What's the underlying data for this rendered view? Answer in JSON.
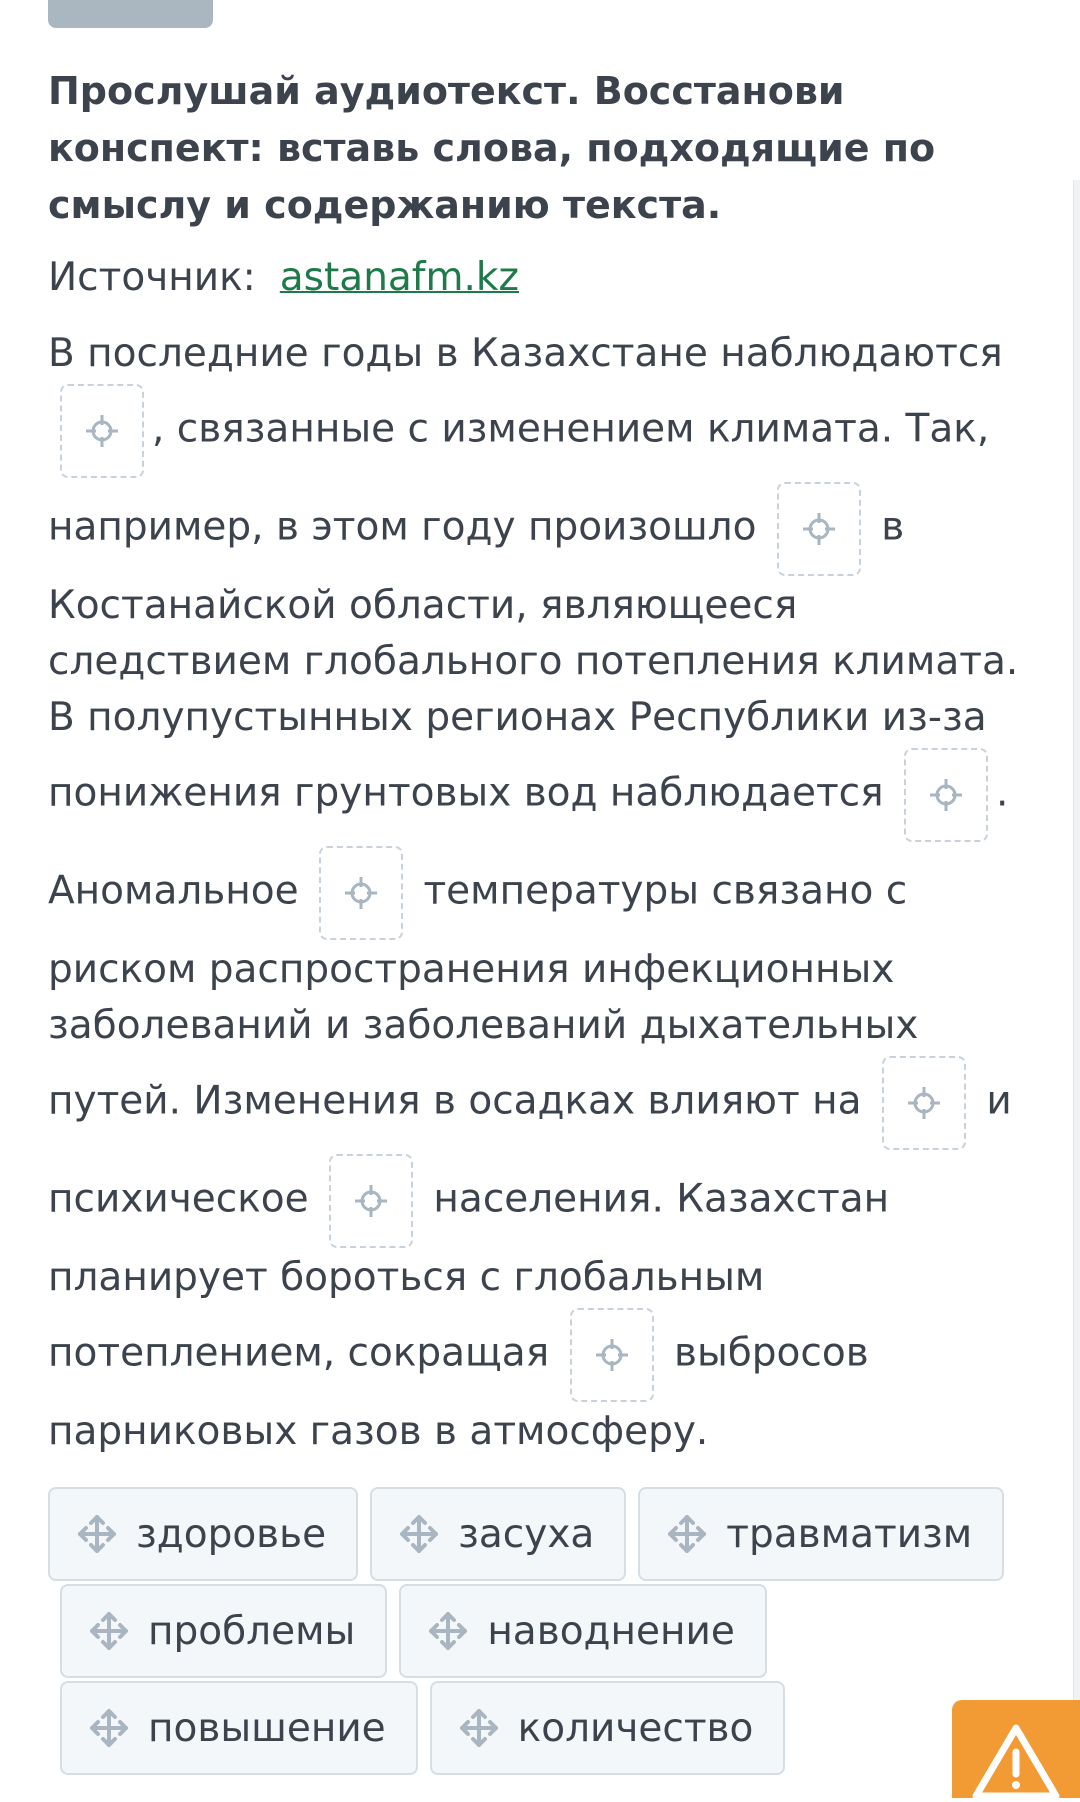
{
  "task": {
    "title": "Прослушай аудиотекст. Восстанови конспект: вставь слова, подходящие по смыслу и содержанию текста.",
    "source_label": "Источник:",
    "source_link": "astanafm.kz"
  },
  "passage": {
    "t1": "В последние годы в Казахстане наблюдаются",
    "t2": ", связанные с изменением климата. Так, например, в этом году произошло",
    "t3": "в Костанайской области, являющееся следствием глобального потепления климата. В полупустынных регионах Республики из-за понижения грунтовых вод наблюдается",
    "t4": ". Аномальное",
    "t5": "температуры связано с риском распространения инфекционных заболеваний и заболеваний дыхательных путей. Изменения в осадках влияют на",
    "t6": "и психическое",
    "t7": "населения. Казахстан планирует бороться с глобальным потеплением, сокращая",
    "t8": "выбросов парниковых газов в атмосферу."
  },
  "word_bank": [
    "здоровье",
    "засуха",
    "травматизм",
    "проблемы",
    "наводнение",
    "повышение",
    "количество"
  ],
  "icons": {
    "gap": "crosshair-icon",
    "chip": "move-arrows-icon",
    "report": "warning-triangle-icon"
  },
  "colors": {
    "text": "#3d434d",
    "link": "#1f7a4a",
    "gap_border": "#c9d2da",
    "chip_bg": "#f4f7fa",
    "chip_border": "#d6dde3",
    "warning": "#f29a33",
    "icon": "#a9b6c1"
  }
}
